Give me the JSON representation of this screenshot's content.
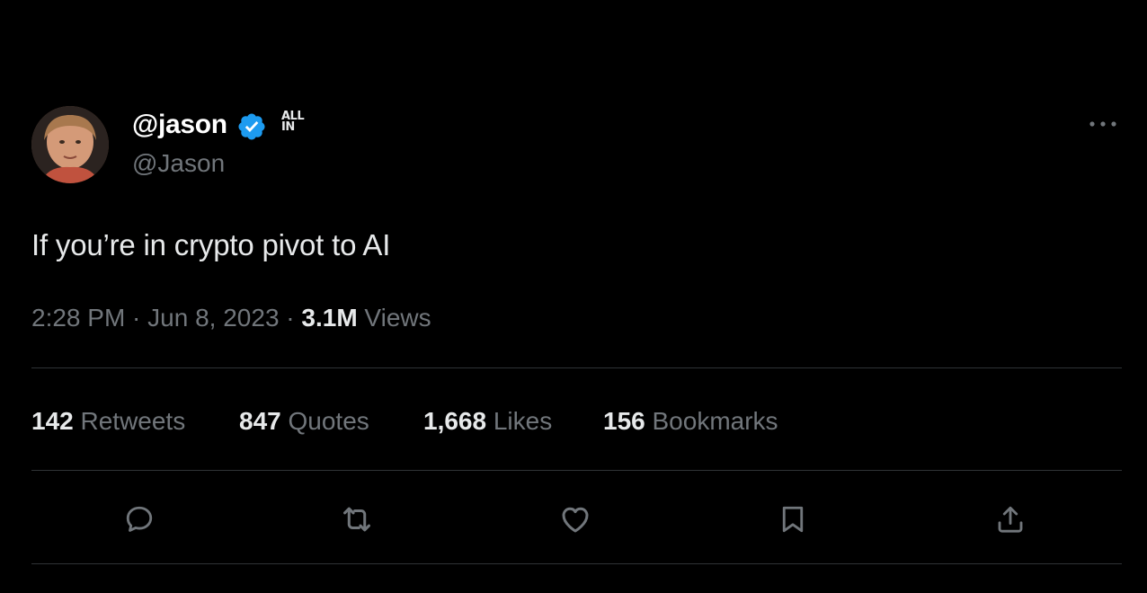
{
  "tweet": {
    "display_name": "@jason",
    "handle": "@Jason",
    "affiliation_badge": {
      "line1": "ALL",
      "line2": "IN"
    },
    "text": "If you’re in crypto pivot to AI",
    "time": "2:28 PM",
    "separator": " · ",
    "date": "Jun 8, 2023",
    "views_count": "3.1M",
    "views_label": " Views"
  },
  "stats": {
    "retweets": {
      "count": "142",
      "label": " Retweets"
    },
    "quotes": {
      "count": "847",
      "label": " Quotes"
    },
    "likes": {
      "count": "1,668",
      "label": " Likes"
    },
    "bookmarks": {
      "count": "156",
      "label": " Bookmarks"
    }
  },
  "icons": {
    "verified": "verified-badge-icon",
    "more": "more-horizontal-icon",
    "reply": "reply-icon",
    "retweet": "retweet-icon",
    "like": "heart-icon",
    "bookmark": "bookmark-icon",
    "share": "share-icon"
  },
  "colors": {
    "background": "#000000",
    "primary_text": "#e7e9ea",
    "secondary_text": "#71767b",
    "verified_blue": "#1d9bf0",
    "divider": "#2f3336"
  }
}
